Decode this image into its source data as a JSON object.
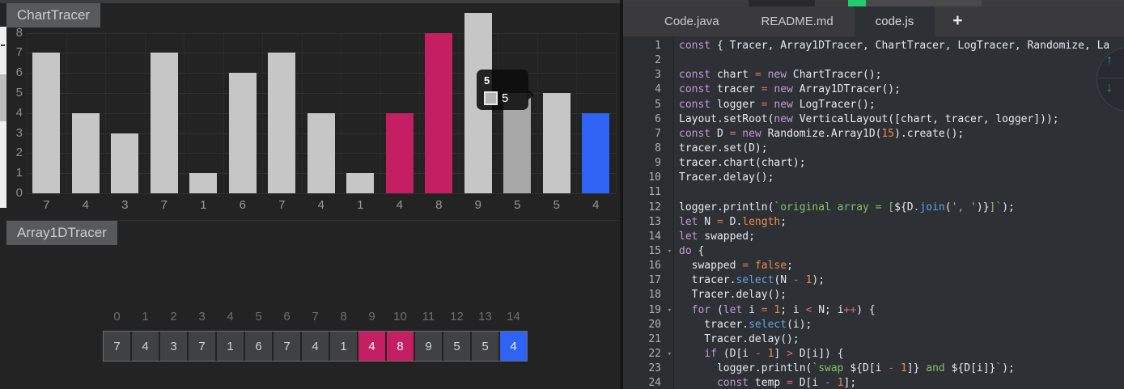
{
  "chart_tracer": {
    "title": "ChartTracer"
  },
  "array_tracer": {
    "title": "Array1DTracer",
    "indices": [
      "0",
      "1",
      "2",
      "3",
      "4",
      "5",
      "6",
      "7",
      "8",
      "9",
      "10",
      "11",
      "12",
      "13",
      "14"
    ],
    "values": [
      "7",
      "4",
      "3",
      "7",
      "1",
      "6",
      "7",
      "4",
      "1",
      "4",
      "8",
      "9",
      "5",
      "5",
      "4"
    ],
    "selected_indices": [
      9,
      10
    ],
    "patched_indices": [
      14
    ],
    "cell_colors": {
      "default": "#3f4143",
      "selected": "#c51f63",
      "patched": "#2e63f5"
    },
    "text_colors": {
      "default": "#d0d1d3",
      "highlight": "#f2f2f2"
    }
  },
  "chart_data": {
    "type": "bar",
    "title": "ChartTracer",
    "categories": [
      "7",
      "4",
      "3",
      "7",
      "1",
      "6",
      "7",
      "4",
      "1",
      "4",
      "8",
      "9",
      "5",
      "5",
      "4"
    ],
    "values": [
      7,
      4,
      3,
      7,
      1,
      6,
      7,
      4,
      1,
      4,
      8,
      9,
      5,
      5,
      4
    ],
    "xlabel": "",
    "ylabel": "",
    "ylim": [
      0,
      9
    ],
    "yticks": [
      0,
      1,
      2,
      3,
      4,
      5,
      6,
      7,
      8
    ],
    "grid": true,
    "legend": "none",
    "bar_default_color": "#c6c6c6",
    "bar_hover_color": "#a8a8a8",
    "bar_selected_color": "#c51f63",
    "bar_patched_color": "#2e63f5",
    "selected_indices": [
      9,
      10
    ],
    "patched_indices": [
      14
    ],
    "hover_index": 12,
    "tooltip": {
      "title": "5",
      "value": "5",
      "swatch_color": "#b5b5b5"
    }
  },
  "top_bar": {
    "progress_accent": "#24cb71"
  },
  "editor": {
    "tabs": [
      {
        "label": "Code.java",
        "active": false
      },
      {
        "label": "README.md",
        "active": false
      },
      {
        "label": "code.js",
        "active": true
      }
    ],
    "new_tab_label": "+",
    "fold_lines": [
      15,
      19,
      22
    ],
    "colors": {
      "keyword": "#c897d8",
      "operator": "#e06c75",
      "number": "#f08c4a",
      "string": "#85c06d",
      "function": "#61a5e2",
      "plain": "#e9eaec"
    },
    "code_lines": [
      [
        [
          "keyword",
          "const"
        ],
        [
          "plain",
          " { Tracer, Array1DTracer, ChartTracer, LogTracer, Randomize, La"
        ]
      ],
      [],
      [
        [
          "keyword",
          "const"
        ],
        [
          "plain",
          " chart "
        ],
        [
          "operator",
          "="
        ],
        [
          "plain",
          " "
        ],
        [
          "keyword",
          "new"
        ],
        [
          "plain",
          " ChartTracer();"
        ]
      ],
      [
        [
          "keyword",
          "const"
        ],
        [
          "plain",
          " tracer "
        ],
        [
          "operator",
          "="
        ],
        [
          "plain",
          " "
        ],
        [
          "keyword",
          "new"
        ],
        [
          "plain",
          " Array1DTracer();"
        ]
      ],
      [
        [
          "keyword",
          "const"
        ],
        [
          "plain",
          " logger "
        ],
        [
          "operator",
          "="
        ],
        [
          "plain",
          " "
        ],
        [
          "keyword",
          "new"
        ],
        [
          "plain",
          " LogTracer();"
        ]
      ],
      [
        [
          "plain",
          "Layout.setRoot("
        ],
        [
          "keyword",
          "new"
        ],
        [
          "plain",
          " VerticalLayout([chart, tracer, logger]));"
        ]
      ],
      [
        [
          "keyword",
          "const"
        ],
        [
          "plain",
          " D "
        ],
        [
          "operator",
          "="
        ],
        [
          "plain",
          " "
        ],
        [
          "keyword",
          "new"
        ],
        [
          "plain",
          " Randomize.Array1D("
        ],
        [
          "number",
          "15"
        ],
        [
          "plain",
          ").create();"
        ]
      ],
      [
        [
          "plain",
          "tracer.set(D);"
        ]
      ],
      [
        [
          "plain",
          "tracer.chart(chart);"
        ]
      ],
      [
        [
          "plain",
          "Tracer.delay();"
        ]
      ],
      [],
      [
        [
          "plain",
          "logger.println("
        ],
        [
          "string",
          "`original array = ["
        ],
        [
          "plain",
          "${D."
        ],
        [
          "function",
          "join"
        ],
        [
          "plain",
          "("
        ],
        [
          "string",
          "', '"
        ],
        [
          "plain",
          ")}"
        ],
        [
          "string",
          "]`"
        ],
        [
          "plain",
          ");"
        ]
      ],
      [
        [
          "keyword",
          "let"
        ],
        [
          "plain",
          " N "
        ],
        [
          "operator",
          "="
        ],
        [
          "plain",
          " D."
        ],
        [
          "number",
          "length"
        ],
        [
          "plain",
          ";"
        ]
      ],
      [
        [
          "keyword",
          "let"
        ],
        [
          "plain",
          " swapped;"
        ]
      ],
      [
        [
          "keyword",
          "do"
        ],
        [
          "plain",
          " {"
        ]
      ],
      [
        [
          "plain",
          "  swapped "
        ],
        [
          "operator",
          "="
        ],
        [
          "plain",
          " "
        ],
        [
          "number",
          "false"
        ],
        [
          "plain",
          ";"
        ]
      ],
      [
        [
          "plain",
          "  tracer."
        ],
        [
          "function",
          "select"
        ],
        [
          "plain",
          "(N "
        ],
        [
          "operator",
          "-"
        ],
        [
          "plain",
          " "
        ],
        [
          "number",
          "1"
        ],
        [
          "plain",
          ");"
        ]
      ],
      [
        [
          "plain",
          "  Tracer.delay();"
        ]
      ],
      [
        [
          "plain",
          "  "
        ],
        [
          "keyword",
          "for"
        ],
        [
          "plain",
          " ("
        ],
        [
          "keyword",
          "let"
        ],
        [
          "plain",
          " i "
        ],
        [
          "operator",
          "="
        ],
        [
          "plain",
          " "
        ],
        [
          "number",
          "1"
        ],
        [
          "plain",
          "; i "
        ],
        [
          "operator",
          "<"
        ],
        [
          "plain",
          " N; i"
        ],
        [
          "operator",
          "++"
        ],
        [
          "plain",
          ") {"
        ]
      ],
      [
        [
          "plain",
          "    tracer."
        ],
        [
          "function",
          "select"
        ],
        [
          "plain",
          "(i);"
        ]
      ],
      [
        [
          "plain",
          "    Tracer.delay();"
        ]
      ],
      [
        [
          "plain",
          "    "
        ],
        [
          "keyword",
          "if"
        ],
        [
          "plain",
          " (D[i "
        ],
        [
          "operator",
          "-"
        ],
        [
          "plain",
          " "
        ],
        [
          "number",
          "1"
        ],
        [
          "plain",
          "] "
        ],
        [
          "operator",
          ">"
        ],
        [
          "plain",
          " D[i]) {"
        ]
      ],
      [
        [
          "plain",
          "      logger.println("
        ],
        [
          "string",
          "`swap "
        ],
        [
          "plain",
          "${D[i "
        ],
        [
          "operator",
          "-"
        ],
        [
          "plain",
          " "
        ],
        [
          "number",
          "1"
        ],
        [
          "plain",
          "]}"
        ],
        [
          "string",
          " and "
        ],
        [
          "plain",
          "${D[i]}"
        ],
        [
          "string",
          "`"
        ],
        [
          "plain",
          ");"
        ]
      ],
      [
        [
          "plain",
          "      "
        ],
        [
          "keyword",
          "const"
        ],
        [
          "plain",
          " temp "
        ],
        [
          "operator",
          "="
        ],
        [
          "plain",
          " D[i "
        ],
        [
          "operator",
          "-"
        ],
        [
          "plain",
          " "
        ],
        [
          "number",
          "1"
        ],
        [
          "plain",
          "];"
        ]
      ]
    ]
  },
  "scroll_button": {
    "up_icon": "↑",
    "down_icon": "↓"
  }
}
